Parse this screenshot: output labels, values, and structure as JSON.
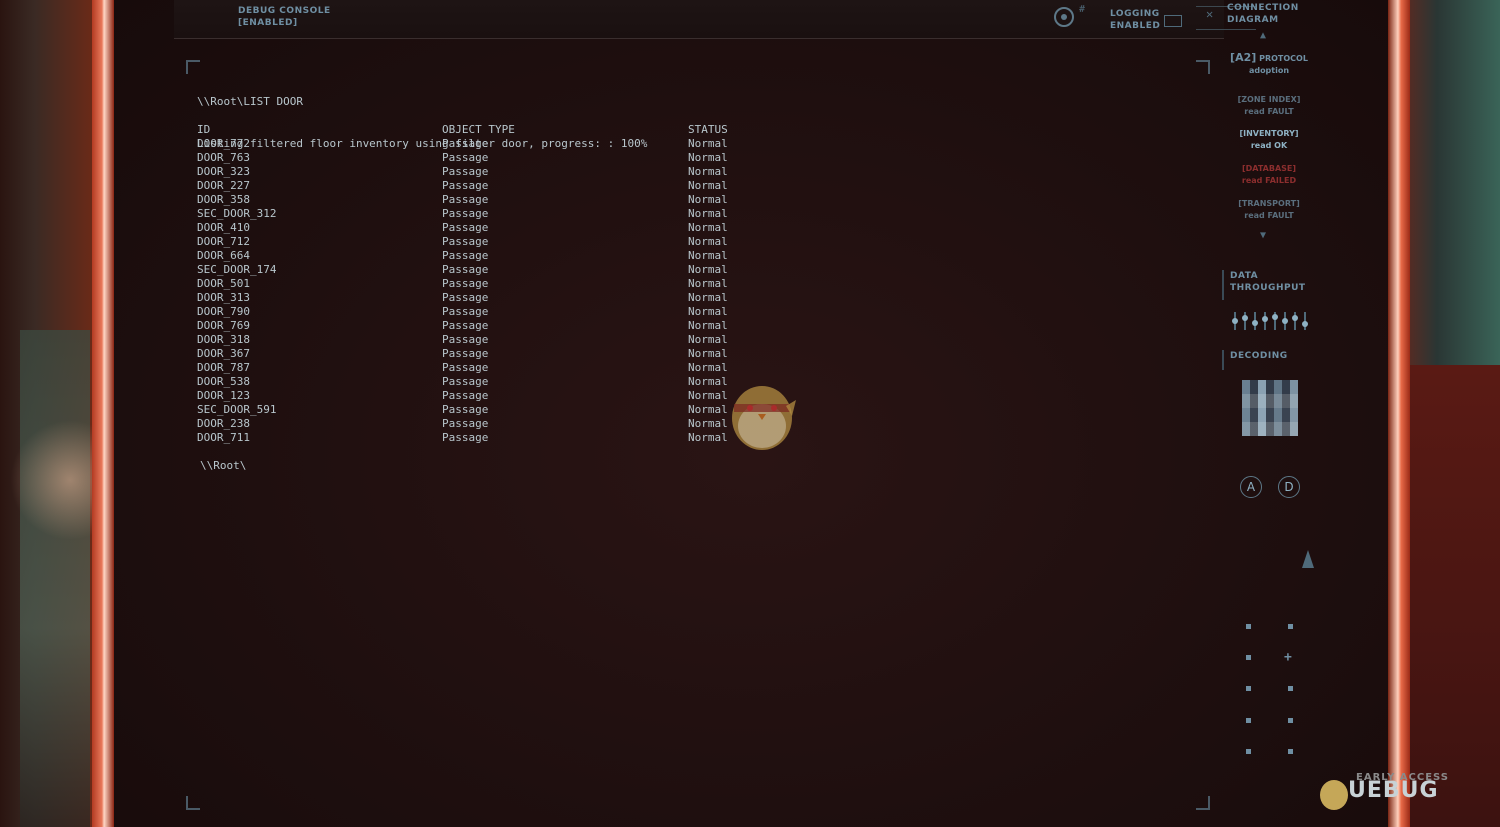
{
  "topbar": {
    "debug_label": "DEBUG CONSOLE",
    "debug_state": "[ENABLED]",
    "logging_label": "LOGGING",
    "logging_state": "ENABLED"
  },
  "terminal": {
    "command": "\\\\Root\\LIST DOOR",
    "status": "Listing filtered floor inventory using filter door, progress: : 100%",
    "headers": [
      "ID",
      "OBJECT TYPE",
      "STATUS"
    ],
    "rows": [
      [
        "DOOR_772",
        "Passage",
        "Normal"
      ],
      [
        "DOOR_763",
        "Passage",
        "Normal"
      ],
      [
        "DOOR_323",
        "Passage",
        "Normal"
      ],
      [
        "DOOR_227",
        "Passage",
        "Normal"
      ],
      [
        "DOOR_358",
        "Passage",
        "Normal"
      ],
      [
        "SEC_DOOR_312",
        "Passage",
        "Normal"
      ],
      [
        "DOOR_410",
        "Passage",
        "Normal"
      ],
      [
        "DOOR_712",
        "Passage",
        "Normal"
      ],
      [
        "DOOR_664",
        "Passage",
        "Normal"
      ],
      [
        "SEC_DOOR_174",
        "Passage",
        "Normal"
      ],
      [
        "DOOR_501",
        "Passage",
        "Normal"
      ],
      [
        "DOOR_313",
        "Passage",
        "Normal"
      ],
      [
        "DOOR_790",
        "Passage",
        "Normal"
      ],
      [
        "DOOR_769",
        "Passage",
        "Normal"
      ],
      [
        "DOOR_318",
        "Passage",
        "Normal"
      ],
      [
        "DOOR_367",
        "Passage",
        "Normal"
      ],
      [
        "DOOR_787",
        "Passage",
        "Normal"
      ],
      [
        "DOOR_538",
        "Passage",
        "Normal"
      ],
      [
        "DOOR_123",
        "Passage",
        "Normal"
      ],
      [
        "SEC_DOOR_591",
        "Passage",
        "Normal"
      ],
      [
        "DOOR_238",
        "Passage",
        "Normal"
      ],
      [
        "DOOR_711",
        "Passage",
        "Normal"
      ]
    ],
    "prompt": "\\\\Root\\"
  },
  "sidebar": {
    "title_line1": "CONNECTION",
    "title_line2": "DIAGRAM",
    "protocol_tag": "[A2]",
    "protocol_line1": "PROTOCOL",
    "protocol_line2": "adoption",
    "items": [
      {
        "name": "[ZONE INDEX]",
        "state": "read FAULT",
        "status": "fault-dim"
      },
      {
        "name": "[INVENTORY]",
        "state": "read OK",
        "status": "ok"
      },
      {
        "name": "[DATABASE]",
        "state": "read FAILED",
        "status": "error"
      },
      {
        "name": "[TRANSPORT]",
        "state": "read FAULT",
        "status": "fault-dim"
      }
    ],
    "throughput_line1": "DATA",
    "throughput_line2": "THROUGHPUT",
    "decoding_label": "DECODING",
    "button_a": "A",
    "button_d": "D"
  },
  "watermark": {
    "text": "UEBUG",
    "sub": "EARLY ACCESS"
  },
  "colors": {
    "hud_blue": "#6f8fa3",
    "terminal_text": "#b8c6cc",
    "fault_red": "#8c2e2e",
    "bezel_orange": "#e8785a"
  }
}
